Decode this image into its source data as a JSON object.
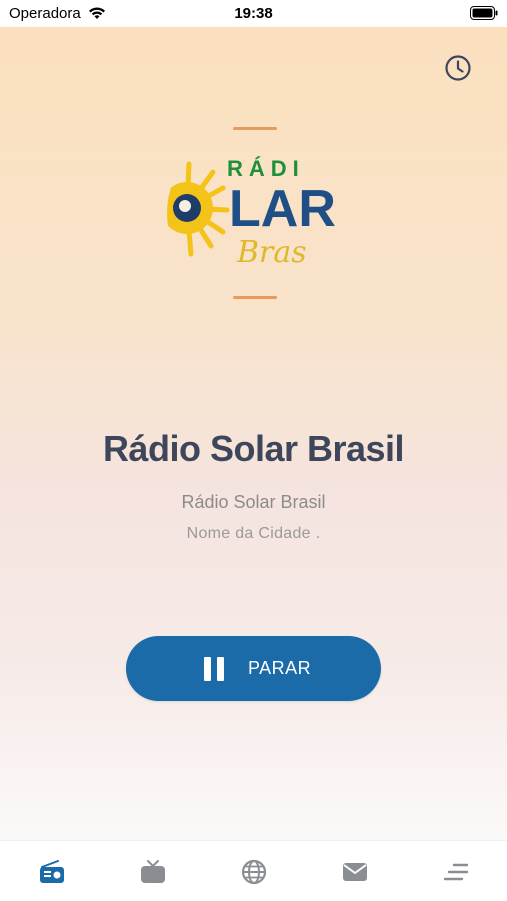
{
  "status_bar": {
    "carrier": "Operadora",
    "time": "19:38"
  },
  "logo": {
    "text_top": "RÁDI",
    "text_main": "LAR",
    "text_script": "Bras"
  },
  "station": {
    "title": "Rádio Solar Brasil",
    "subtitle": "Rádio Solar Brasil",
    "city": "Nome da Cidade ."
  },
  "player": {
    "button_label": "PARAR",
    "state_icon": "pause-icon"
  },
  "tabs": [
    {
      "icon": "radio-icon",
      "active": true
    },
    {
      "icon": "tv-icon",
      "active": false
    },
    {
      "icon": "globe-icon",
      "active": false
    },
    {
      "icon": "mail-icon",
      "active": false
    },
    {
      "icon": "menu-icon",
      "active": false
    }
  ],
  "colors": {
    "accent": "#1b6ba8",
    "title": "#3d465a",
    "tab_active": "#1b6ba8",
    "tab_inactive": "#8a8e93"
  }
}
